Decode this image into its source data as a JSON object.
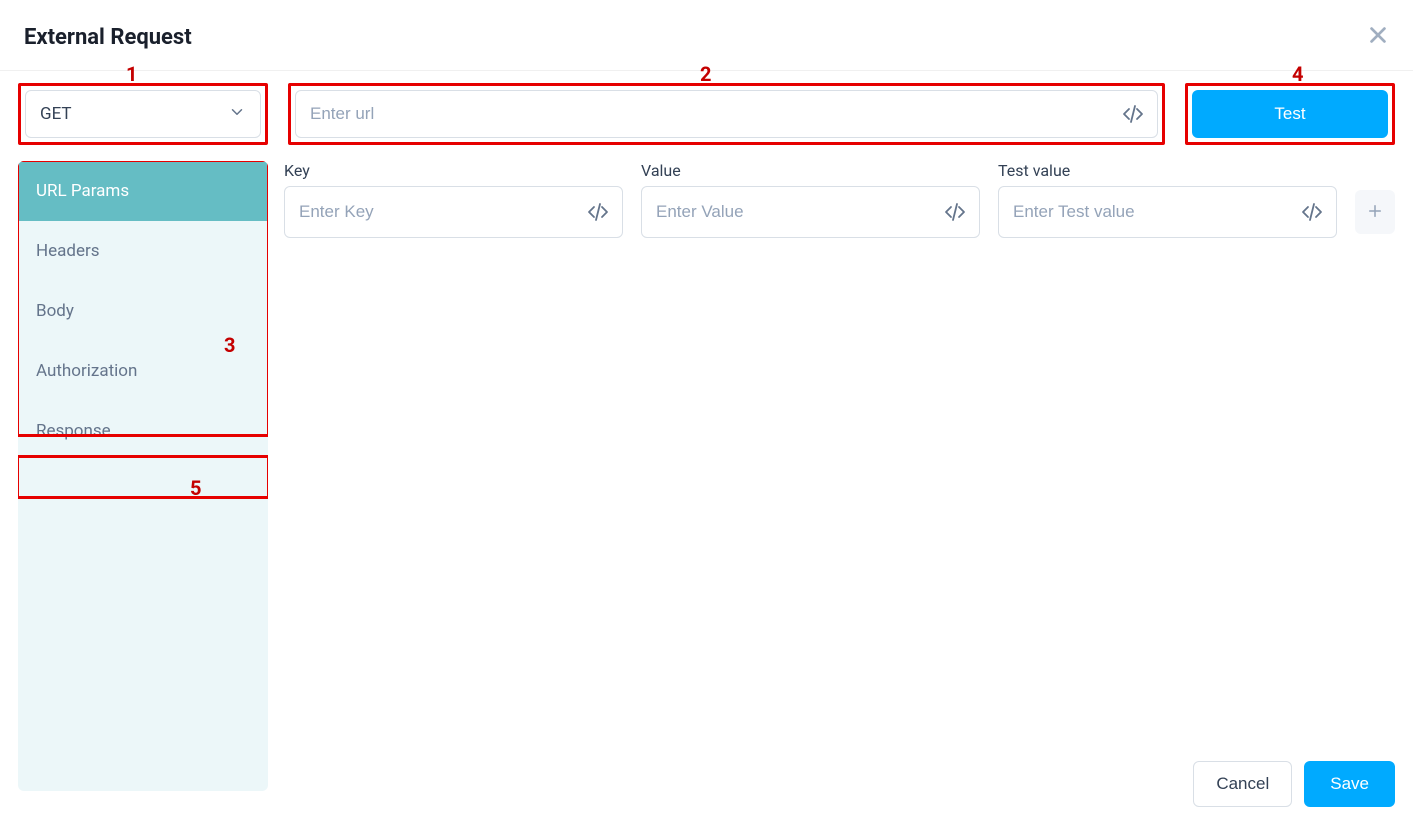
{
  "header": {
    "title": "External Request"
  },
  "method": {
    "selected": "GET"
  },
  "url": {
    "placeholder": "Enter url",
    "value": ""
  },
  "test_button": "Test",
  "sidebar": {
    "items": [
      {
        "label": "URL Params",
        "active": true
      },
      {
        "label": "Headers",
        "active": false
      },
      {
        "label": "Body",
        "active": false
      },
      {
        "label": "Authorization",
        "active": false
      },
      {
        "label": "Response",
        "active": false
      }
    ]
  },
  "params": {
    "key_label": "Key",
    "key_placeholder": "Enter Key",
    "value_label": "Value",
    "value_placeholder": "Enter Value",
    "test_value_label": "Test value",
    "test_value_placeholder": "Enter Test value"
  },
  "footer": {
    "cancel": "Cancel",
    "save": "Save"
  },
  "callouts": {
    "c1": "1",
    "c2": "2",
    "c3": "3",
    "c4": "4",
    "c5": "5"
  }
}
